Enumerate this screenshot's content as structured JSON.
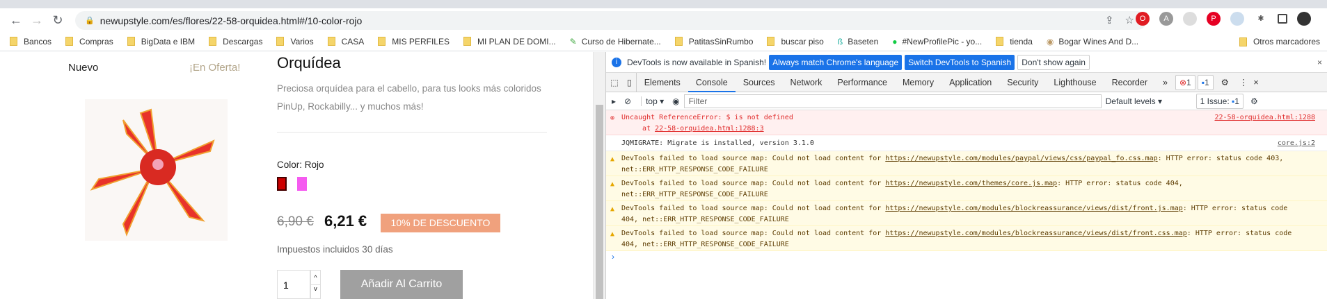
{
  "browser": {
    "url": "newupstyle.com/es/flores/22-58-orquidea.html#/10-color-rojo",
    "bookmarks": [
      "Bancos",
      "Compras",
      "BigData e IBM",
      "Descargas",
      "Varios",
      "CASA",
      "MIS PERFILES",
      "MI PLAN DE DOMI...",
      "Curso de Hibernate...",
      "PatitasSinRumbo",
      "buscar piso",
      "Baseten",
      "#NewProfilePic - yo...",
      "tienda",
      "Bogar Wines And D..."
    ],
    "other_bookmarks": "Otros marcadores"
  },
  "page": {
    "nav_new": "Nuevo",
    "nav_offer": "¡En Oferta!",
    "title": "Orquídea",
    "description": "Preciosa orquídea para el cabello, para tus looks más coloridos PinUp, Rockabilly... y muchos más!",
    "color_label": "Color: Rojo",
    "swatches": [
      "#cc0000",
      "#f55bf0"
    ],
    "old_price": "6,90 €",
    "price": "6,21 €",
    "discount": "10% DE DESCUENTO",
    "tax": "Impuestos incluidos 30 días",
    "quantity": "1",
    "add_to_cart": "Añadir Al Carrito"
  },
  "devtools": {
    "info": "DevTools is now available in Spanish!",
    "btn_match": "Always match Chrome's language",
    "btn_switch": "Switch DevTools to Spanish",
    "btn_dont": "Don't show again",
    "tabs": [
      "Elements",
      "Console",
      "Sources",
      "Network",
      "Performance",
      "Memory",
      "Application",
      "Security",
      "Lighthouse",
      "Recorder"
    ],
    "error_count": "1",
    "message_count": "1",
    "context": "top",
    "filter_placeholder": "Filter",
    "levels": "Default levels ▾",
    "issues": "1 Issue:",
    "issues_count": "1",
    "messages": [
      {
        "type": "error",
        "text": "Uncaught ReferenceError: $ is not defined",
        "sub_pre": "at ",
        "sub_link": "22-58-orquidea.html:1288:3",
        "source": "22-58-orquidea.html:1288"
      },
      {
        "type": "log",
        "text": "JQMIGRATE: Migrate is installed, version 3.1.0",
        "source": "core.js:2"
      },
      {
        "type": "warn",
        "pre": "DevTools failed to load source map: Could not load content for ",
        "link": "https://newupstyle.com/modules/paypal/views/css/paypal_fo.css.map",
        "post": ": HTTP error: status code 403, net::ERR_HTTP_RESPONSE_CODE_FAILURE"
      },
      {
        "type": "warn",
        "pre": "DevTools failed to load source map: Could not load content for ",
        "link": "https://newupstyle.com/themes/core.js.map",
        "post": ": HTTP error: status code 404, net::ERR_HTTP_RESPONSE_CODE_FAILURE"
      },
      {
        "type": "warn",
        "pre": "DevTools failed to load source map: Could not load content for ",
        "link": "https://newupstyle.com/modules/blockreassurance/views/dist/front.js.map",
        "post": ": HTTP error: status code 404, net::ERR_HTTP_RESPONSE_CODE_FAILURE"
      },
      {
        "type": "warn",
        "pre": "DevTools failed to load source map: Could not load content for ",
        "link": "https://newupstyle.com/modules/blockreassurance/views/dist/front.css.map",
        "post": ": HTTP error: status code 404, net::ERR_HTTP_RESPONSE_CODE_FAILURE"
      }
    ]
  }
}
